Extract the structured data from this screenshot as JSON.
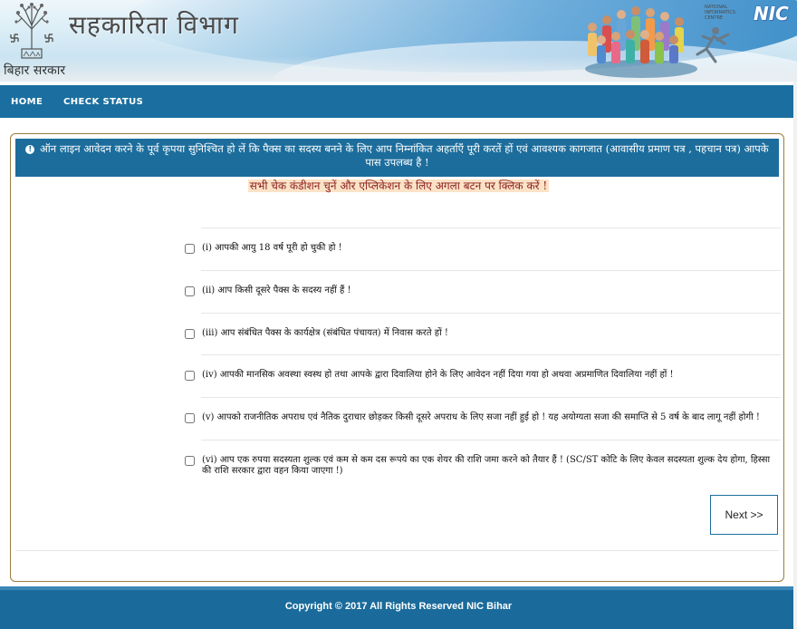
{
  "header": {
    "state_name": "बिहार सरकार",
    "department_title": "सहकारिता विभाग",
    "nic_small_text": "NATIONAL INFORMATICS CENTRE",
    "nic_mark": "NIC",
    "icons": [
      "bihar-emblem-icon",
      "people-illustration-icon",
      "nic-logo-icon"
    ]
  },
  "nav": {
    "items": [
      {
        "label": "HOME"
      },
      {
        "label": "CHECK STATUS"
      }
    ]
  },
  "main": {
    "alert_icon": "info-circle-icon",
    "alert_text": "ऑन लाइन आवेदन करने के पूर्व कृपया सुनिश्चित हो लें कि पैक्स का सदस्य बनने के लिए आप निम्नांकित अहर्ताएँ पूरी करतें हों एवं आवश्यक कागजात (आवासीय प्रमाण पत्र , पहचान पत्र) आपके पास उपलब्ध है !",
    "instruction": "सभी चेक कंडीशन चुनें और एप्लिकेशन के लिए अगला बटन पर क्लिक करें !",
    "conditions": [
      {
        "text": "(i) आपकी आयु 18 वर्ष पूरी हो चुकी हो !",
        "checked": false
      },
      {
        "text": "(ii) आप किसी दूसरे पैक्स के सदस्य नहीं हैं !",
        "checked": false
      },
      {
        "text": "(iii) आप संबंधित पैक्स के कार्यक्षेत्र (संबंधित पंचायत) में निवास करते हों !",
        "checked": false
      },
      {
        "text": "(iv) आपकी मानसिक अवस्था स्वस्थ हो तथा आपके द्वारा दिवालिया होने के लिए आवेदन नहीं दिया गया हो अथवा अप्रमाणित दिवालिया नहीं हों !",
        "checked": false
      },
      {
        "text": "(v) आपको राजनीतिक अपराध एवं नैतिक दुराचार छोड़कर किसी दूसरे अपराध के लिए सजा नहीं हुई हो ! यह अयोग्यता सजा की समाप्ति से 5 वर्ष के बाद लागू नहीं होगी !",
        "checked": false
      },
      {
        "text": "(vi) आप एक रुपया सदस्यता शुल्क एवं कम से कम दस रूपये का एक शेयर की राशि जमा करने को तैयार हैं ! (SC/ST कोटि के लिए केवल सदस्यता शुल्क देय होगा, हिस्सा की राशि सरकार द्वारा वहन किया जाएगा !)",
        "checked": false
      }
    ],
    "next_button": "Next >>"
  },
  "footer": {
    "copyright": "Copyright © 2017 All Rights Reserved NIC Bihar"
  },
  "colors": {
    "nav_bg": "#1b6fa0",
    "alert_bg": "#1c6d9c",
    "instruction_highlight": "#fbe3c7",
    "panel_border": "#9b7b3d",
    "footer_bg": "#1a6b9b"
  }
}
